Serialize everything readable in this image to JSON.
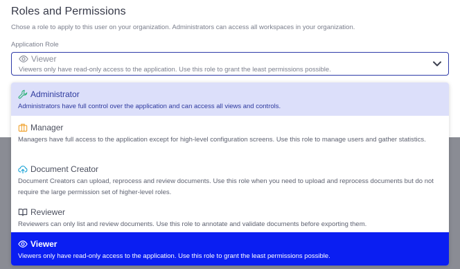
{
  "section": {
    "title": "Roles and Permissions",
    "description": "Chose a role to apply to this user on your organization. Administrators can access all workspaces in your organization."
  },
  "field": {
    "label": "Application Role",
    "selected": {
      "title": "Viewer",
      "description": "Viewers only have read-only access to the application. Use this role to grant the least permissions possible."
    }
  },
  "options": [
    {
      "title": "Administrator",
      "icon": "wrench-icon",
      "icon_color": "#2fb37a",
      "description": "Administrators have full control over the application and can access all views and controls."
    },
    {
      "title": "Manager",
      "icon": "briefcase-icon",
      "icon_color": "#f0a22e",
      "description": "Managers have full access to the application except for high-level configuration screens. Use this role to manage users and gather statistics."
    },
    {
      "title": "Document Creator",
      "icon": "cloud-upload-icon",
      "icon_color": "#1aa3d6",
      "description": "Document Creators can upload, reprocess and review documents. Use this role when you need to upload and reprocess documents but do not require the large permission set of higher-level roles."
    },
    {
      "title": "Reviewer",
      "icon": "book-open-icon",
      "icon_color": "#4b4f5e",
      "description": "Reviewers can only list and review documents. Use this role to annotate and validate documents before exporting them."
    },
    {
      "title": "Viewer",
      "icon": "eye-icon",
      "icon_color": "#ffffff",
      "description": "Viewers only have read-only access to the application. Use this role to grant the least permissions possible."
    }
  ],
  "colors": {
    "accent": "#0a1ef2",
    "hover_highlight": "#dcdffa",
    "border_focus": "#2d3aa8"
  }
}
